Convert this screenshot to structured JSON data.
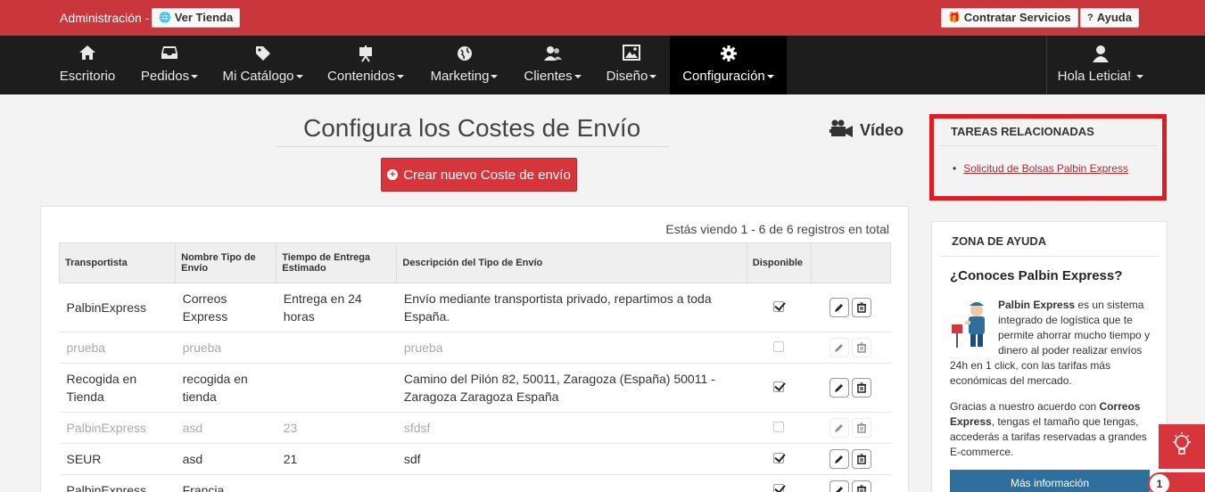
{
  "topbar": {
    "admin_label": "Administración -",
    "ver_tienda": "Ver Tienda",
    "contratar": "Contratar Servicios",
    "ayuda": "Ayuda",
    "color": "#c9363c"
  },
  "nav": {
    "items": [
      {
        "label": "Escritorio",
        "icon": "home-icon"
      },
      {
        "label": "Pedidos",
        "icon": "inbox-icon"
      },
      {
        "label": "Mi Catálogo",
        "icon": "tag-icon"
      },
      {
        "label": "Contenidos",
        "icon": "easel-icon"
      },
      {
        "label": "Marketing",
        "icon": "globe-icon"
      },
      {
        "label": "Clientes",
        "icon": "users-icon"
      },
      {
        "label": "Diseño",
        "icon": "picture-icon"
      },
      {
        "label": "Configuración",
        "icon": "gear-icon"
      }
    ],
    "user": "Hola Leticia!"
  },
  "main": {
    "title": "Configura los Costes de Envío",
    "video": "Vídeo",
    "create_button": "Crear nuevo Coste de envío",
    "records": "Estás viendo 1 - 6 de 6 registros en total",
    "columns": [
      "Transportista",
      "Nombre Tipo de Envío",
      "Tiempo de Entrega Estimado",
      "Descripción del Tipo de Envío",
      "Disponible"
    ],
    "rows": [
      {
        "carrier": "PalbinExpress",
        "name": "Correos Express",
        "time": "Entrega en 24 horas",
        "desc": "Envío mediante transportista privado, repartimos a toda España.",
        "available": true
      },
      {
        "carrier": "prueba",
        "name": "prueba",
        "time": "",
        "desc": "prueba",
        "available": false
      },
      {
        "carrier": "Recogida en Tienda",
        "name": "recogida en tienda",
        "time": "",
        "desc": "Camino del Pilón 82, 50011, Zaragoza (España) 50011 - Zaragoza Zaragoza España",
        "available": true
      },
      {
        "carrier": "PalbinExpress",
        "name": "asd",
        "time": "23",
        "desc": "sfdsf",
        "available": false
      },
      {
        "carrier": "SEUR",
        "name": "asd",
        "time": "21",
        "desc": "sdf",
        "available": true
      },
      {
        "carrier": "PalbinExpress",
        "name": "Francia",
        "time": "",
        "desc": "",
        "available": true
      }
    ]
  },
  "sidebar": {
    "related_title": "TAREAS RELACIONADAS",
    "related_link": "Solicitud de Bolsas Palbin Express",
    "help_title": "ZONA DE AYUDA",
    "help_question": "¿Conoces Palbin Express?",
    "p1_bold": "Palbin Express",
    "p1_text": " es un sistema integrado de logística que te permite ahorrar mucho tiempo y dinero al poder realizar envíos 24h en 1 click, con las tarifas más económicas del mercado.",
    "p2_a": "Gracias a nuestro acuerdo con ",
    "p2_bold": "Correos Express",
    "p2_b": ", tengas el tamaño que tengas, accederás a tarifas reservadas a grandes E-commerce.",
    "more_button": "Más información",
    "badge_count": "1"
  }
}
